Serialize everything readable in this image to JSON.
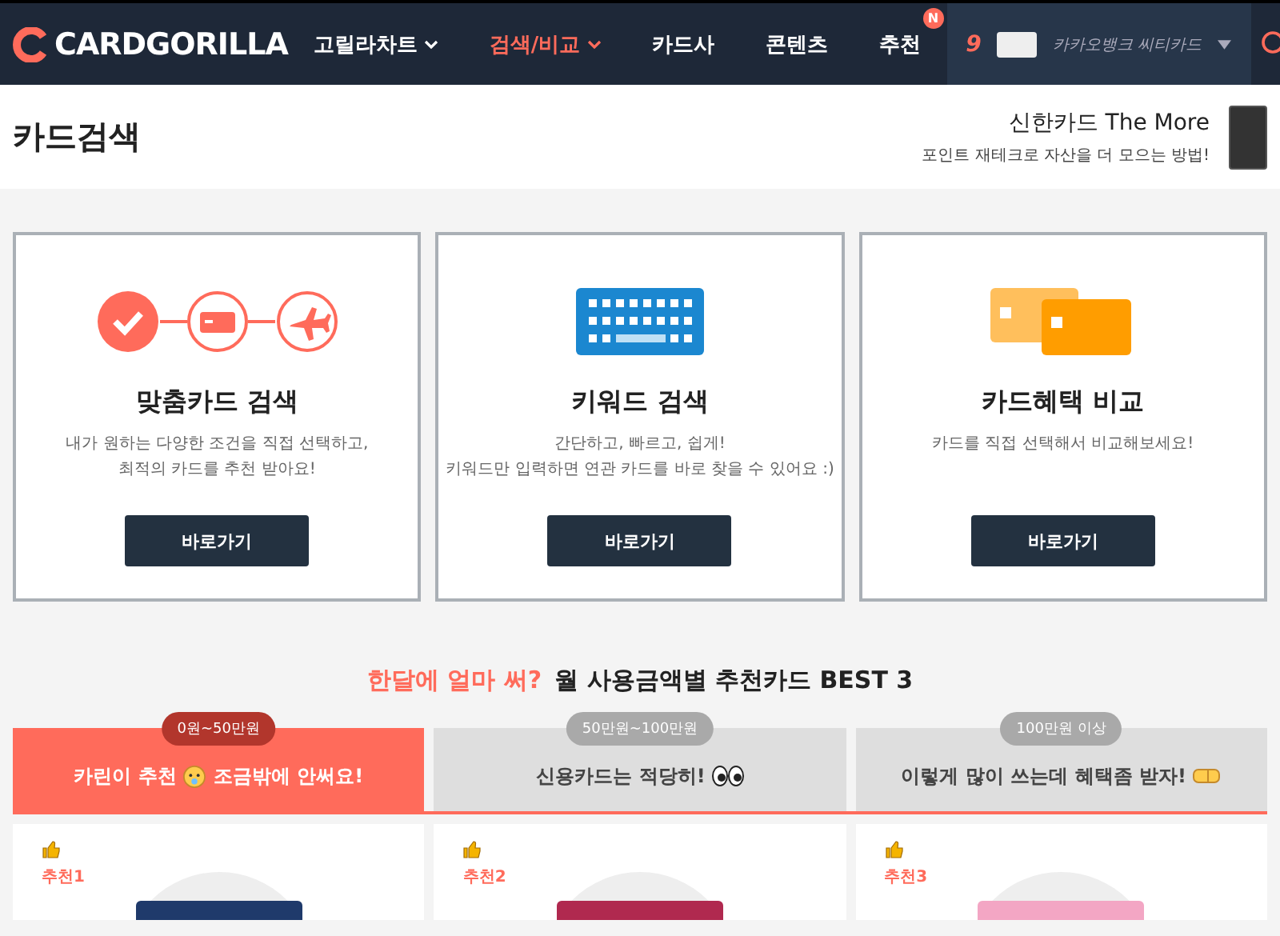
{
  "brand": {
    "name": "CARDGORILLA"
  },
  "nav": [
    {
      "label": "고릴라차트",
      "selected": false,
      "dropdown": true
    },
    {
      "label": "검색/비교",
      "selected": true,
      "dropdown": true
    },
    {
      "label": "카드사",
      "selected": false,
      "dropdown": false
    },
    {
      "label": "콘텐츠",
      "selected": false,
      "dropdown": false
    },
    {
      "label": "추천",
      "selected": false,
      "dropdown": false,
      "badge": "N"
    }
  ],
  "ranking": {
    "rank": "9",
    "card": "카카오뱅크 씨티카드"
  },
  "page_title": "카드검색",
  "promo": {
    "title": "신한카드 The More",
    "subtitle": "포인트 재테크로 자산을 더 모으는 방법!"
  },
  "search_cards": [
    {
      "kind": "steps",
      "title": "맞춤카드 검색",
      "lines": [
        "내가 원하는 다양한 조건을 직접 선택하고,",
        "최적의 카드를 추천 받아요!"
      ],
      "button": "바로가기"
    },
    {
      "kind": "keyboard",
      "title": "키워드 검색",
      "lines": [
        "간단하고, 빠르고, 쉽게!",
        "키워드만 입력하면 연관 카드를 바로 찾을 수 있어요 :)"
      ],
      "button": "바로가기"
    },
    {
      "kind": "cards",
      "title": "카드혜택 비교",
      "lines": [
        "카드를 직접 선택해서 비교해보세요!"
      ],
      "button": "바로가기"
    }
  ],
  "best": {
    "highlight": "한달에 얼마 써?",
    "title": "월 사용금액별 추천카드 BEST 3"
  },
  "spend_tabs": [
    {
      "range": "0원~50만원",
      "label": "카린이 추천",
      "label_after": "조금밖에 안써요!",
      "selected": true
    },
    {
      "range": "50만원~100만원",
      "label": "신용카드는 적당히!",
      "selected": false
    },
    {
      "range": "100만원 이상",
      "label": "이렇게 많이 쓰는데 혜택좀 받자!",
      "selected": false
    }
  ],
  "recommendations": [
    {
      "label": "추천1",
      "color": "#1f3a6b"
    },
    {
      "label": "추천2",
      "color": "#b0294f"
    },
    {
      "label": "추천3",
      "color": "#f3a6c4"
    }
  ]
}
